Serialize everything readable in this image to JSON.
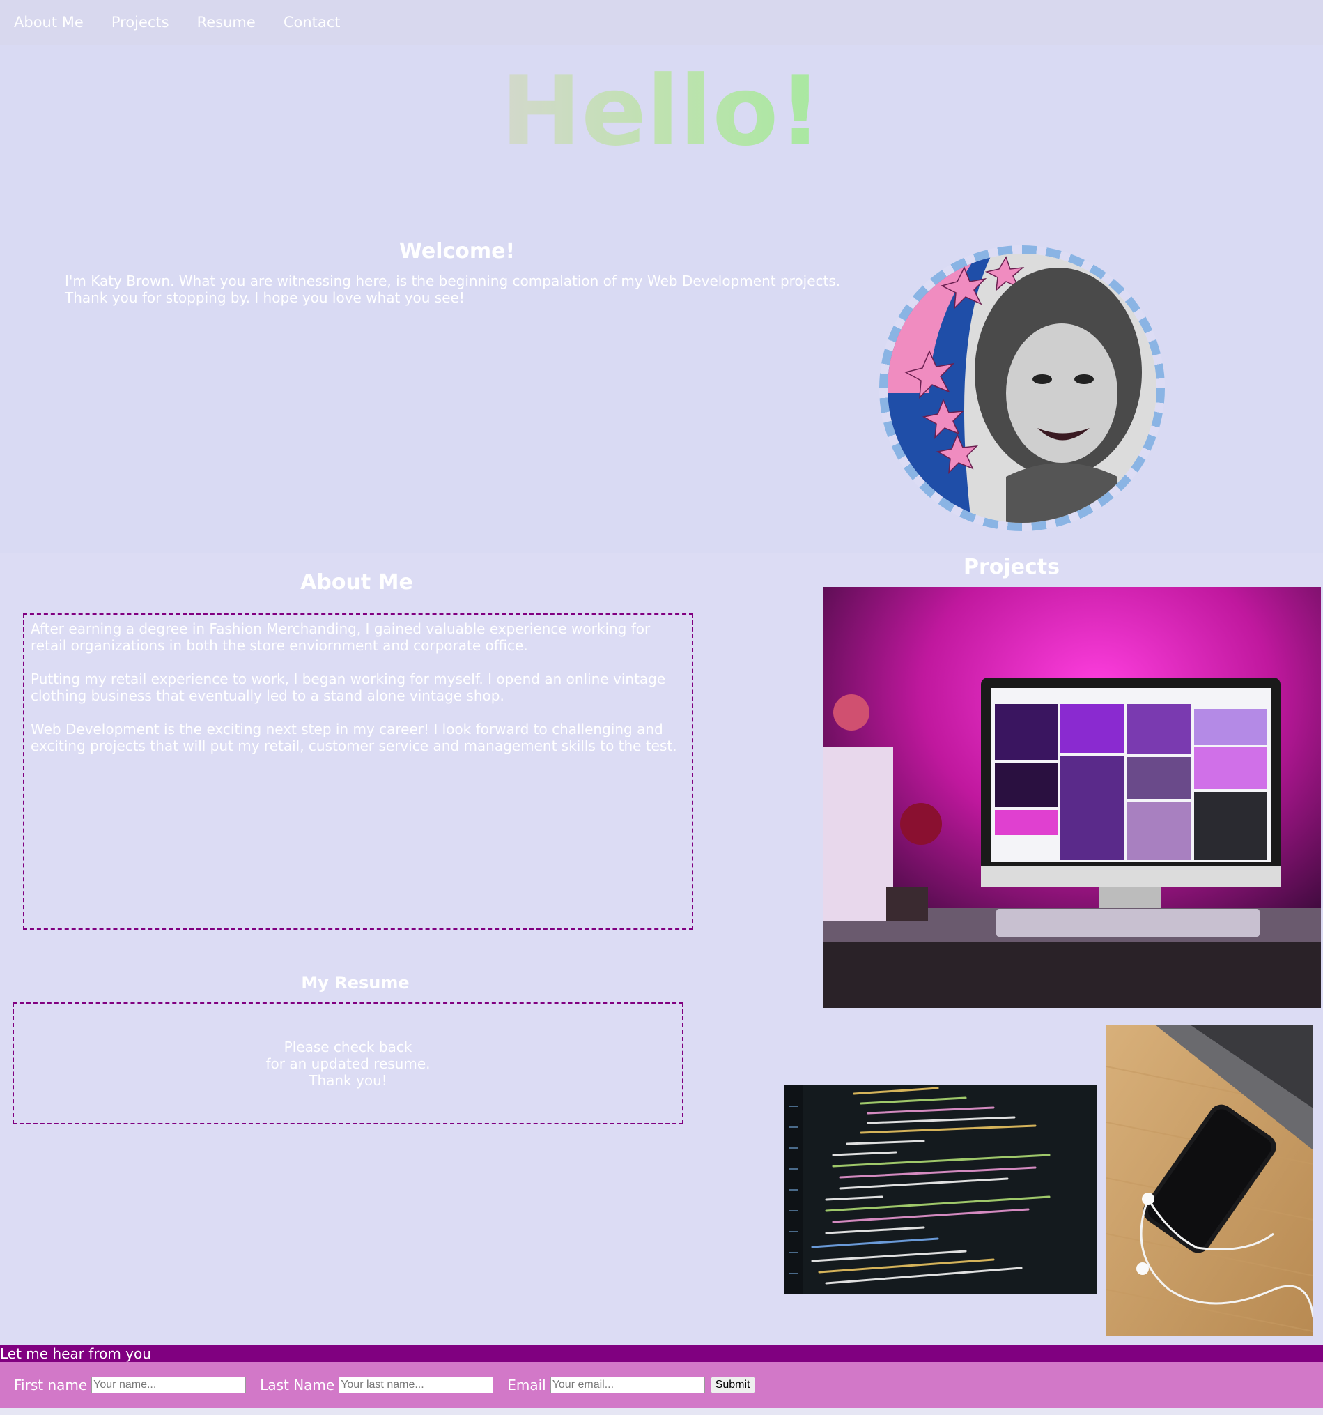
{
  "nav": {
    "items": [
      "About Me",
      "Projects",
      "Resume",
      "Contact"
    ]
  },
  "hero": {
    "title": "Hello!"
  },
  "welcome": {
    "heading": "Welcome!",
    "text": "I'm Katy Brown. What you are witnessing here, is the beginning compalation of my Web Development projects. Thank you for stopping by. I hope you love what you see!"
  },
  "about": {
    "heading": "About Me",
    "paragraphs": [
      "After earning a degree in Fashion Merchanding, I gained valuable experience working for retail organizations in both the store enviornment and corporate office.",
      "Putting my retail experience to work, I began working for myself. I opend an online vintage clothing business that eventually led to a stand alone vintage shop.",
      "Web Development is the exciting next step in my career! I look forward to challenging and exciting projects that will put my retail, customer service and management skills to the test."
    ]
  },
  "resume": {
    "heading": "My Resume",
    "lines": [
      "Please check back",
      "for an updated resume.",
      "Thank you!"
    ]
  },
  "projects": {
    "heading": "Projects"
  },
  "contact": {
    "heading": "Let me hear from you",
    "first_name_label": "First name",
    "first_name_placeholder": "Your name...",
    "last_name_label": "Last Name",
    "last_name_placeholder": "Your last name...",
    "email_label": "Email",
    "email_placeholder": "Your email...",
    "submit_label": "Submit"
  },
  "colors": {
    "page_bg": "#dcdcf4",
    "accent_purple": "#800080",
    "form_bg": "#d278c8"
  }
}
